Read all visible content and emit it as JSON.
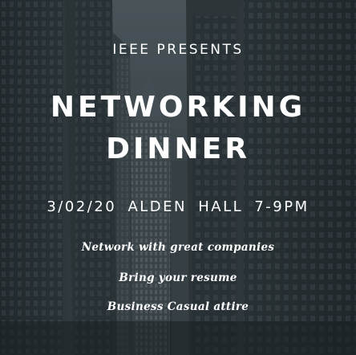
{
  "poster": {
    "presenter": "IEEE PRESENTS",
    "title_line_1": "NETWORKING",
    "title_line_2": "DINNER",
    "details": "3/02/20  ALDEN HALL  7-9PM",
    "notes": [
      "Network with great companies",
      "Bring your resume",
      "Business Casual attire"
    ]
  },
  "colors": {
    "text": "#ffffff",
    "background": "#2a3236"
  }
}
